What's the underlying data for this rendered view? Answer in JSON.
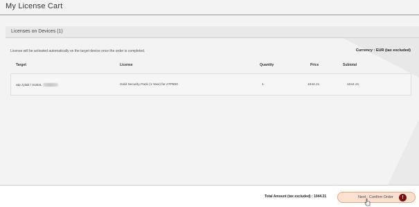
{
  "header": {
    "title": "My License Cart"
  },
  "section": {
    "title": "Licenses on Devices (1)"
  },
  "info": {
    "activation_note": "License will be activated automatically on the target device once the order is completed.",
    "currency": "Currency : EUR (tax excluded)"
  },
  "table": {
    "columns": [
      "Target",
      "License",
      "Quantity",
      "Price",
      "Subtotal"
    ],
    "rows": [
      {
        "target": "atp zylab / S1B2L",
        "license": "Gold Security Pack (1 Year) for ATP800",
        "quantity": "1",
        "price": "1044.21",
        "subtotal": "1044.21"
      }
    ]
  },
  "footer": {
    "total": "Total Amount (tax excluded) : 1044.21",
    "next_label": "Next : Confirm Order",
    "badge": "!"
  },
  "colors": {
    "accent_button": "#fbe0cf",
    "badge": "#7a1010"
  }
}
